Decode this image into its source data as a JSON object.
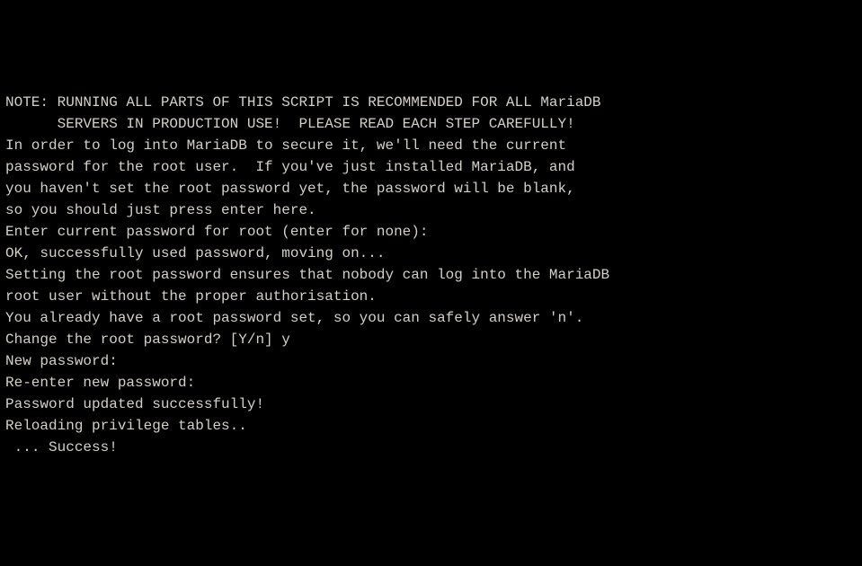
{
  "lines": {
    "l1": "NOTE: RUNNING ALL PARTS OF THIS SCRIPT IS RECOMMENDED FOR ALL MariaDB",
    "l2": "      SERVERS IN PRODUCTION USE!  PLEASE READ EACH STEP CAREFULLY!",
    "l3": "",
    "l4": "In order to log into MariaDB to secure it, we'll need the current",
    "l5": "password for the root user.  If you've just installed MariaDB, and",
    "l6": "you haven't set the root password yet, the password will be blank,",
    "l7": "so you should just press enter here.",
    "l8": "",
    "l9": "Enter current password for root (enter for none):",
    "l10": "OK, successfully used password, moving on...",
    "l11": "",
    "l12": "Setting the root password ensures that nobody can log into the MariaDB",
    "l13": "root user without the proper authorisation.",
    "l14": "",
    "l15": "You already have a root password set, so you can safely answer 'n'.",
    "l16": "",
    "l17": "Change the root password? [Y/n] y",
    "l18": "New password:",
    "l19": "Re-enter new password:",
    "l20": "Password updated successfully!",
    "l21": "Reloading privilege tables..",
    "l22": " ... Success!"
  }
}
